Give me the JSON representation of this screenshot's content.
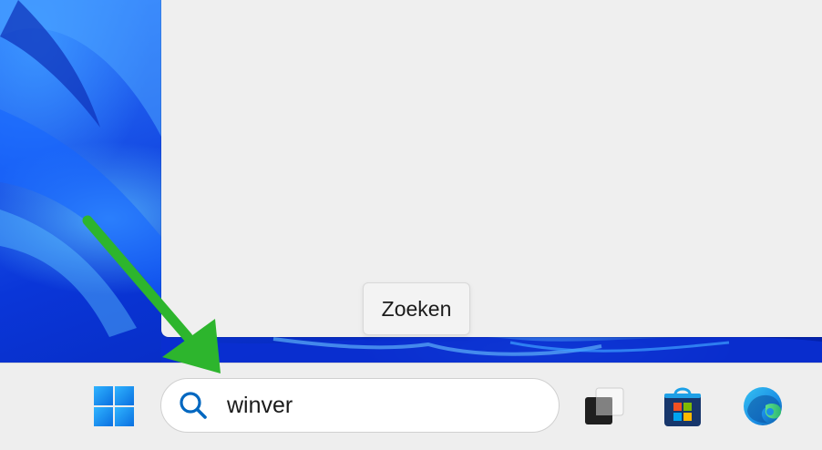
{
  "desktop": {
    "wallpaper": "windows-11-bloom-blue"
  },
  "search_panel": {
    "tooltip": "Zoeken"
  },
  "taskbar": {
    "start_icon": "windows-logo-icon",
    "search": {
      "icon": "search-icon",
      "value": "winver"
    },
    "pinned": [
      {
        "name": "task-view-icon"
      },
      {
        "name": "microsoft-store-icon"
      },
      {
        "name": "edge-icon"
      }
    ]
  },
  "annotation": {
    "arrow_color": "#2db52d"
  },
  "colors": {
    "accent": "#0067c0",
    "taskbar_bg": "#eeeeee",
    "panel_bg": "#efefef"
  }
}
